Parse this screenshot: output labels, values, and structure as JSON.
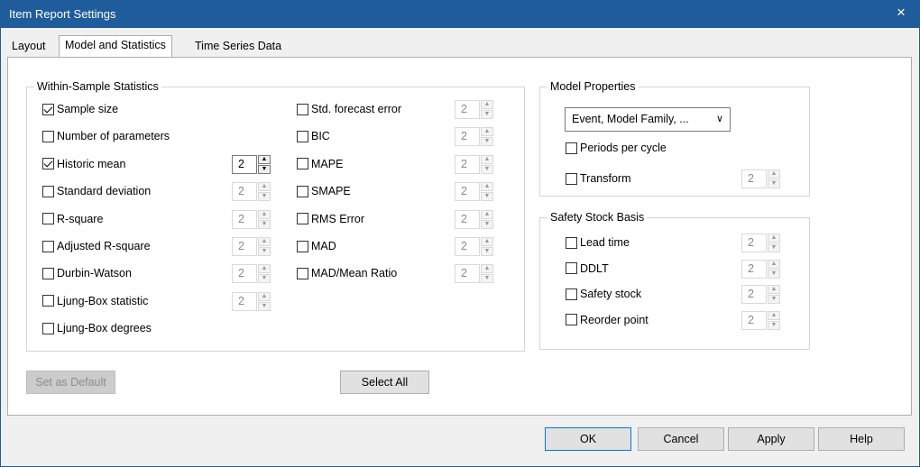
{
  "window": {
    "title": "Item Report Settings",
    "close_glyph": "×"
  },
  "tabs": [
    {
      "label": "Layout"
    },
    {
      "label": "Model and Statistics"
    },
    {
      "label": "Time Series Data"
    }
  ],
  "within_sample": {
    "title": "Within-Sample Statistics",
    "left": [
      {
        "label": "Sample size",
        "checked": true,
        "spin": null
      },
      {
        "label": "Number of parameters",
        "checked": false,
        "spin": null
      },
      {
        "label": "Historic mean",
        "checked": true,
        "spin": "2"
      },
      {
        "label": "Standard deviation",
        "checked": false,
        "spin": "2"
      },
      {
        "label": "R-square",
        "checked": false,
        "spin": "2"
      },
      {
        "label": "Adjusted R-square",
        "checked": false,
        "spin": "2"
      },
      {
        "label": "Durbin-Watson",
        "checked": false,
        "spin": "2"
      },
      {
        "label": "Ljung-Box statistic",
        "checked": false,
        "spin": "2"
      },
      {
        "label": "Ljung-Box degrees",
        "checked": false,
        "spin": null
      }
    ],
    "right": [
      {
        "label": "Std. forecast error",
        "checked": false,
        "spin": "2"
      },
      {
        "label": "BIC",
        "checked": false,
        "spin": "2"
      },
      {
        "label": "MAPE",
        "checked": false,
        "spin": "2"
      },
      {
        "label": "SMAPE",
        "checked": false,
        "spin": "2"
      },
      {
        "label": "RMS Error",
        "checked": false,
        "spin": "2"
      },
      {
        "label": "MAD",
        "checked": false,
        "spin": "2"
      },
      {
        "label": "MAD/Mean Ratio",
        "checked": false,
        "spin": "2"
      }
    ]
  },
  "model_properties": {
    "title": "Model Properties",
    "dropdown_value": "Event, Model Family, ...",
    "dropdown_icon": "chevron-down-icon",
    "periods_label": "Periods per cycle",
    "periods_checked": false,
    "transform_label": "Transform",
    "transform_checked": false,
    "transform_value": "2"
  },
  "safety_stock": {
    "title": "Safety Stock Basis",
    "items": [
      {
        "label": "Lead time",
        "checked": false,
        "spin": "2"
      },
      {
        "label": "DDLT",
        "checked": false,
        "spin": "2"
      },
      {
        "label": "Safety stock",
        "checked": false,
        "spin": "2"
      },
      {
        "label": "Reorder point",
        "checked": false,
        "spin": "2"
      }
    ]
  },
  "buttons": {
    "set_default": "Set as Default",
    "select_all": "Select All",
    "ok": "OK",
    "cancel": "Cancel",
    "apply": "Apply",
    "help": "Help"
  },
  "colors": {
    "titlebar": "#1f5c9b",
    "focus_border": "#0078d7"
  }
}
